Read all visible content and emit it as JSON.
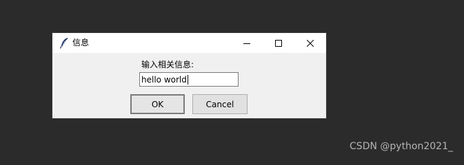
{
  "window": {
    "title": "信息",
    "icon": "feather-icon",
    "controls": {
      "minimize_icon": "minimize-icon",
      "maximize_icon": "maximize-icon",
      "close_icon": "close-icon"
    }
  },
  "form": {
    "prompt_label": "输入相关信息:",
    "input_value": "hello world"
  },
  "buttons": {
    "ok_label": "OK",
    "cancel_label": "Cancel"
  },
  "watermark": "CSDN @python2021_",
  "colors": {
    "desktop_background": "#2b2b2b",
    "dialog_background": "#f0f0f0",
    "titlebar_background": "#ffffff"
  }
}
